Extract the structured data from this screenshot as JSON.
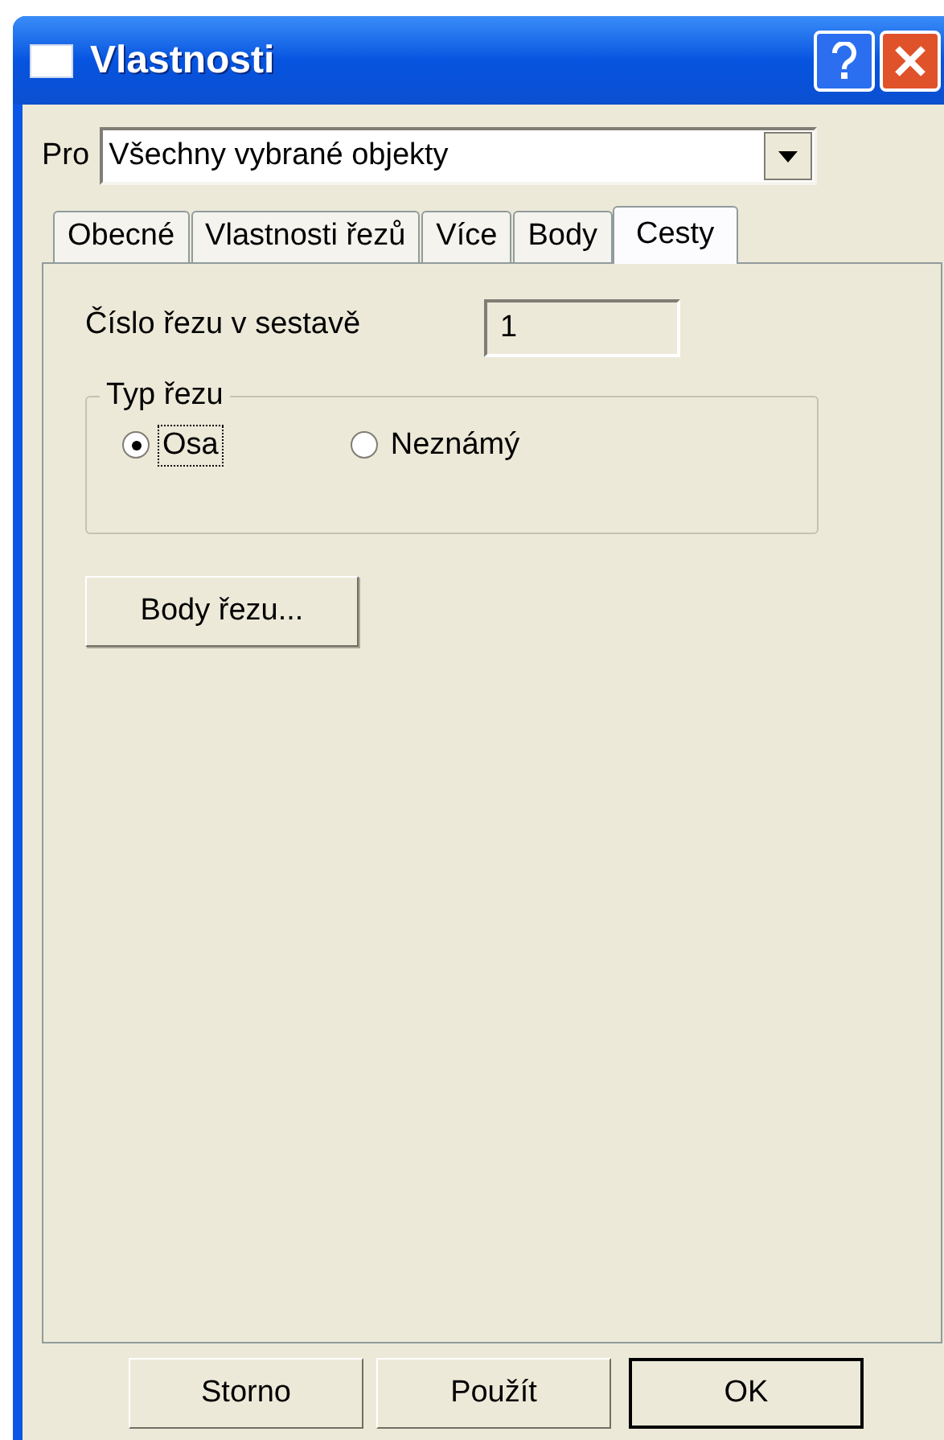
{
  "window": {
    "title": "Vlastnosti"
  },
  "scope": {
    "label": "Pro",
    "value": "Všechny vybrané objekty"
  },
  "tabs": [
    {
      "label": "Obecné",
      "selected": false
    },
    {
      "label": "Vlastnosti řezů",
      "selected": false
    },
    {
      "label": "Více",
      "selected": false
    },
    {
      "label": "Body",
      "selected": false
    },
    {
      "label": "Cesty",
      "selected": true
    }
  ],
  "section_number": {
    "label": "Číslo řezu v sestavě",
    "value": "1"
  },
  "section_type": {
    "title": "Typ řezu",
    "options": [
      {
        "label": "Osa",
        "selected": true,
        "focused": true
      },
      {
        "label": "Neznámý",
        "selected": false,
        "focused": false
      }
    ]
  },
  "points_button": {
    "label": "Body řezu..."
  },
  "buttons": [
    {
      "label": "Storno",
      "default": false
    },
    {
      "label": "Použít",
      "default": false
    },
    {
      "label": "OK",
      "default": true
    }
  ]
}
